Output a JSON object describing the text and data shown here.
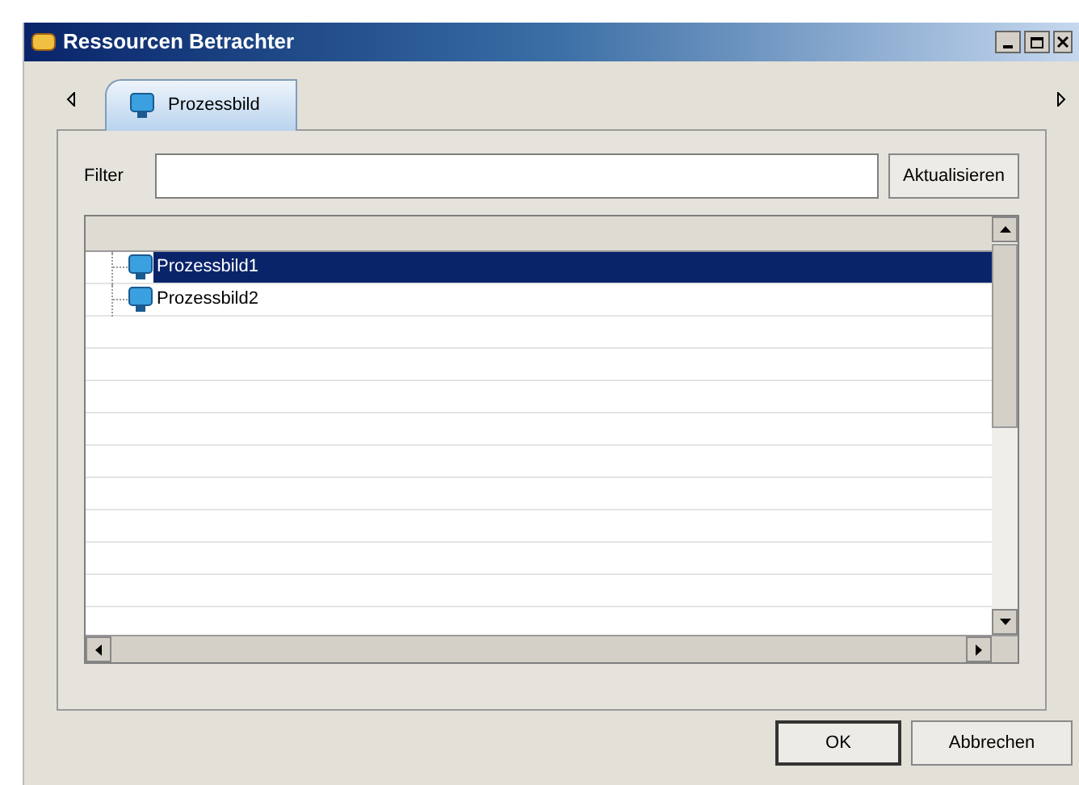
{
  "window": {
    "title": "Ressourcen Betrachter"
  },
  "tabs": [
    {
      "label": "Prozessbild",
      "selected": true
    }
  ],
  "filter": {
    "label": "Filter",
    "button": "Aktualisieren"
  },
  "tree": {
    "items": [
      {
        "label": "Prozessbild1",
        "selected": true
      },
      {
        "label": "Prozessbild2",
        "selected": false
      }
    ]
  },
  "buttons": [
    {
      "label": "OK",
      "default": true
    },
    {
      "label": "Abbrechen",
      "default": false
    }
  ]
}
